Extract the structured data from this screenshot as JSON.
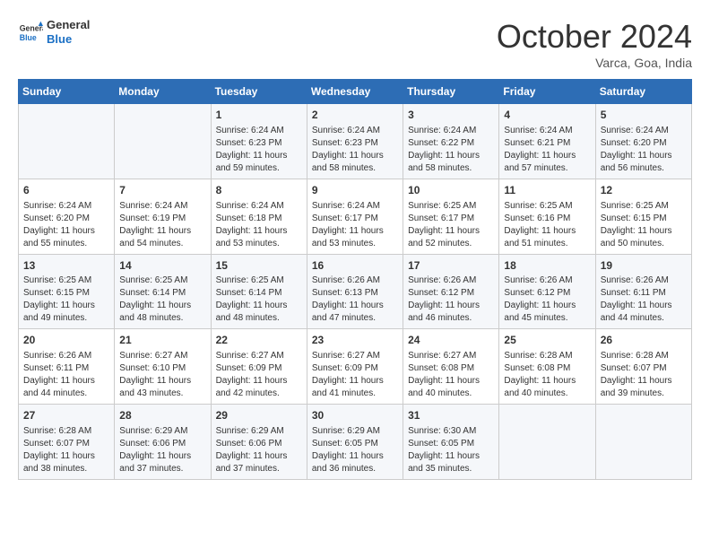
{
  "logo": {
    "line1": "General",
    "line2": "Blue"
  },
  "title": "October 2024",
  "subtitle": "Varca, Goa, India",
  "days_of_week": [
    "Sunday",
    "Monday",
    "Tuesday",
    "Wednesday",
    "Thursday",
    "Friday",
    "Saturday"
  ],
  "weeks": [
    [
      {
        "day": "",
        "info": ""
      },
      {
        "day": "",
        "info": ""
      },
      {
        "day": "1",
        "info": "Sunrise: 6:24 AM\nSunset: 6:23 PM\nDaylight: 11 hours and 59 minutes."
      },
      {
        "day": "2",
        "info": "Sunrise: 6:24 AM\nSunset: 6:23 PM\nDaylight: 11 hours and 58 minutes."
      },
      {
        "day": "3",
        "info": "Sunrise: 6:24 AM\nSunset: 6:22 PM\nDaylight: 11 hours and 58 minutes."
      },
      {
        "day": "4",
        "info": "Sunrise: 6:24 AM\nSunset: 6:21 PM\nDaylight: 11 hours and 57 minutes."
      },
      {
        "day": "5",
        "info": "Sunrise: 6:24 AM\nSunset: 6:20 PM\nDaylight: 11 hours and 56 minutes."
      }
    ],
    [
      {
        "day": "6",
        "info": "Sunrise: 6:24 AM\nSunset: 6:20 PM\nDaylight: 11 hours and 55 minutes."
      },
      {
        "day": "7",
        "info": "Sunrise: 6:24 AM\nSunset: 6:19 PM\nDaylight: 11 hours and 54 minutes."
      },
      {
        "day": "8",
        "info": "Sunrise: 6:24 AM\nSunset: 6:18 PM\nDaylight: 11 hours and 53 minutes."
      },
      {
        "day": "9",
        "info": "Sunrise: 6:24 AM\nSunset: 6:17 PM\nDaylight: 11 hours and 53 minutes."
      },
      {
        "day": "10",
        "info": "Sunrise: 6:25 AM\nSunset: 6:17 PM\nDaylight: 11 hours and 52 minutes."
      },
      {
        "day": "11",
        "info": "Sunrise: 6:25 AM\nSunset: 6:16 PM\nDaylight: 11 hours and 51 minutes."
      },
      {
        "day": "12",
        "info": "Sunrise: 6:25 AM\nSunset: 6:15 PM\nDaylight: 11 hours and 50 minutes."
      }
    ],
    [
      {
        "day": "13",
        "info": "Sunrise: 6:25 AM\nSunset: 6:15 PM\nDaylight: 11 hours and 49 minutes."
      },
      {
        "day": "14",
        "info": "Sunrise: 6:25 AM\nSunset: 6:14 PM\nDaylight: 11 hours and 48 minutes."
      },
      {
        "day": "15",
        "info": "Sunrise: 6:25 AM\nSunset: 6:14 PM\nDaylight: 11 hours and 48 minutes."
      },
      {
        "day": "16",
        "info": "Sunrise: 6:26 AM\nSunset: 6:13 PM\nDaylight: 11 hours and 47 minutes."
      },
      {
        "day": "17",
        "info": "Sunrise: 6:26 AM\nSunset: 6:12 PM\nDaylight: 11 hours and 46 minutes."
      },
      {
        "day": "18",
        "info": "Sunrise: 6:26 AM\nSunset: 6:12 PM\nDaylight: 11 hours and 45 minutes."
      },
      {
        "day": "19",
        "info": "Sunrise: 6:26 AM\nSunset: 6:11 PM\nDaylight: 11 hours and 44 minutes."
      }
    ],
    [
      {
        "day": "20",
        "info": "Sunrise: 6:26 AM\nSunset: 6:11 PM\nDaylight: 11 hours and 44 minutes."
      },
      {
        "day": "21",
        "info": "Sunrise: 6:27 AM\nSunset: 6:10 PM\nDaylight: 11 hours and 43 minutes."
      },
      {
        "day": "22",
        "info": "Sunrise: 6:27 AM\nSunset: 6:09 PM\nDaylight: 11 hours and 42 minutes."
      },
      {
        "day": "23",
        "info": "Sunrise: 6:27 AM\nSunset: 6:09 PM\nDaylight: 11 hours and 41 minutes."
      },
      {
        "day": "24",
        "info": "Sunrise: 6:27 AM\nSunset: 6:08 PM\nDaylight: 11 hours and 40 minutes."
      },
      {
        "day": "25",
        "info": "Sunrise: 6:28 AM\nSunset: 6:08 PM\nDaylight: 11 hours and 40 minutes."
      },
      {
        "day": "26",
        "info": "Sunrise: 6:28 AM\nSunset: 6:07 PM\nDaylight: 11 hours and 39 minutes."
      }
    ],
    [
      {
        "day": "27",
        "info": "Sunrise: 6:28 AM\nSunset: 6:07 PM\nDaylight: 11 hours and 38 minutes."
      },
      {
        "day": "28",
        "info": "Sunrise: 6:29 AM\nSunset: 6:06 PM\nDaylight: 11 hours and 37 minutes."
      },
      {
        "day": "29",
        "info": "Sunrise: 6:29 AM\nSunset: 6:06 PM\nDaylight: 11 hours and 37 minutes."
      },
      {
        "day": "30",
        "info": "Sunrise: 6:29 AM\nSunset: 6:05 PM\nDaylight: 11 hours and 36 minutes."
      },
      {
        "day": "31",
        "info": "Sunrise: 6:30 AM\nSunset: 6:05 PM\nDaylight: 11 hours and 35 minutes."
      },
      {
        "day": "",
        "info": ""
      },
      {
        "day": "",
        "info": ""
      }
    ]
  ]
}
